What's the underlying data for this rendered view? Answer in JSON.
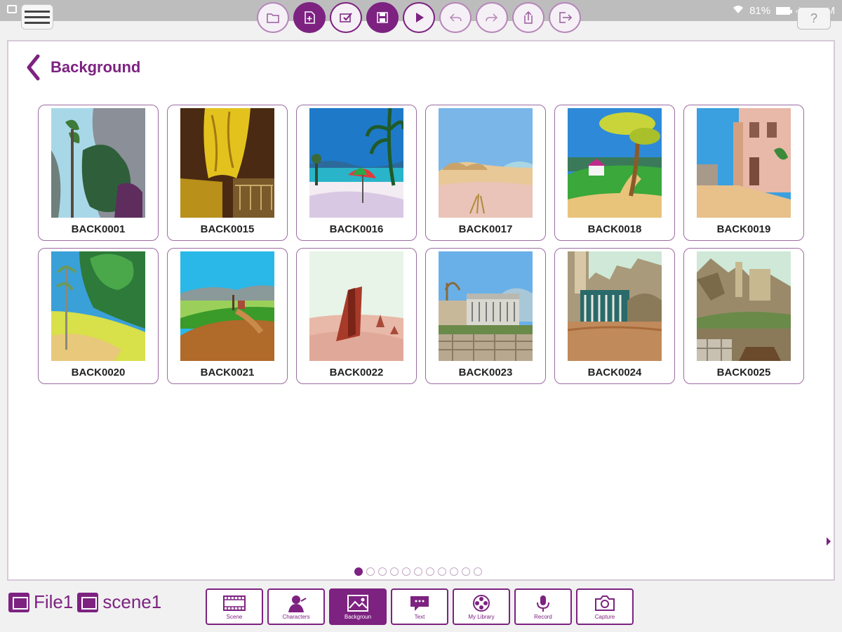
{
  "status": {
    "battery": "81%",
    "time": "4:43 PM"
  },
  "toolbar": {
    "icons": [
      "folder-icon",
      "new-file-icon",
      "checklist-icon",
      "save-icon",
      "play-icon",
      "undo-icon",
      "redo-icon",
      "export-icon",
      "exit-icon"
    ],
    "active_index": 1,
    "help_label": "?"
  },
  "page": {
    "title": "Background"
  },
  "backgrounds": [
    {
      "label": "BACK0001",
      "icon": "cliffs-scene-thumbnail"
    },
    {
      "label": "BACK0015",
      "icon": "cave-scene-thumbnail"
    },
    {
      "label": "BACK0016",
      "icon": "beach-umbrella-scene-thumbnail"
    },
    {
      "label": "BACK0017",
      "icon": "sand-dunes-scene-thumbnail"
    },
    {
      "label": "BACK0018",
      "icon": "tree-hill-scene-thumbnail"
    },
    {
      "label": "BACK0019",
      "icon": "street-scene-thumbnail"
    },
    {
      "label": "BACK0020",
      "icon": "forest-path-scene-thumbnail"
    },
    {
      "label": "BACK0021",
      "icon": "countryside-scene-thumbnail"
    },
    {
      "label": "BACK0022",
      "icon": "desert-rock-scene-thumbnail"
    },
    {
      "label": "BACK0023",
      "icon": "old-building-scene-thumbnail"
    },
    {
      "label": "BACK0024",
      "icon": "castle-ruins-scene-thumbnail"
    },
    {
      "label": "BACK0025",
      "icon": "fortress-scene-thumbnail"
    }
  ],
  "pagination": {
    "total": 11,
    "current": 1
  },
  "file": {
    "file_name": "File1",
    "scene_name": "scene1"
  },
  "tabs": [
    {
      "label": "Scene",
      "icon": "film-strip-icon"
    },
    {
      "label": "Characters",
      "icon": "character-icon"
    },
    {
      "label": "Backgroun",
      "icon": "picture-icon"
    },
    {
      "label": "Text",
      "icon": "speech-bubble-icon"
    },
    {
      "label": "My Library",
      "icon": "film-reel-icon"
    },
    {
      "label": "Record",
      "icon": "microphone-icon"
    },
    {
      "label": "Capture",
      "icon": "camera-icon"
    }
  ],
  "active_tab": 2,
  "colors": {
    "accent": "#7d2281",
    "statusbar": "#bdbdbd"
  }
}
